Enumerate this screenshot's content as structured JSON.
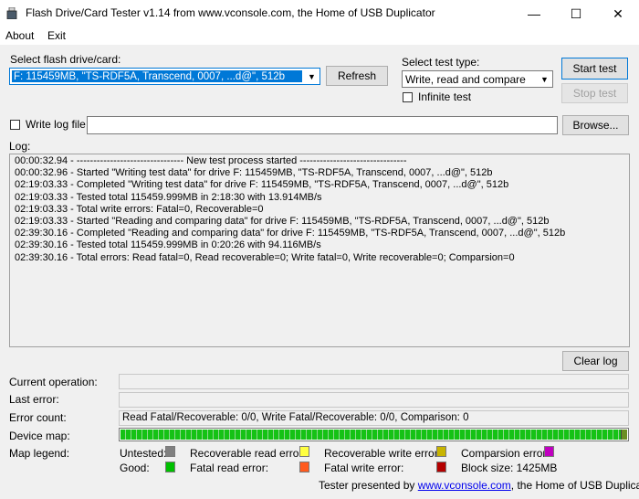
{
  "window": {
    "title": "Flash Drive/Card Tester v1.14 from www.vconsole.com, the Home of USB Duplicator",
    "minimize": "—",
    "maximize": "☐",
    "close": "✕"
  },
  "menu": {
    "about": "About",
    "exit": "Exit"
  },
  "drive": {
    "label": "Select flash drive/card:",
    "selected": "F: 115459MB, \"TS-RDF5A, Transcend, 0007, ...d@\", 512b",
    "refresh": "Refresh"
  },
  "test_type": {
    "label": "Select test type:",
    "selected": "Write, read and compare",
    "infinite_label": "Infinite test"
  },
  "buttons": {
    "start": "Start test",
    "stop": "Stop test",
    "browse": "Browse...",
    "clear_log": "Clear log"
  },
  "write_log": {
    "label": "Write log file",
    "value": ""
  },
  "log": {
    "label": "Log:",
    "lines": [
      "00:00:32.94 - -------------------------------- New test process started --------------------------------",
      "00:00:32.96 - Started \"Writing test data\" for drive F: 115459MB, \"TS-RDF5A, Transcend, 0007, ...d@\", 512b",
      "02:19:03.33 - Completed \"Writing test data\" for drive F: 115459MB, \"TS-RDF5A, Transcend, 0007, ...d@\", 512b",
      "02:19:03.33 - Tested total 115459.999MB in 2:18:30 with 13.914MB/s",
      "02:19:03.33 - Total write errors: Fatal=0, Recoverable=0",
      "02:19:03.33 - Started \"Reading and comparing data\" for drive F: 115459MB, \"TS-RDF5A, Transcend, 0007, ...d@\", 512b",
      "02:39:30.16 - Completed \"Reading and comparing data\" for drive F: 115459MB, \"TS-RDF5A, Transcend, 0007, ...d@\", 512b",
      "02:39:30.16 - Tested total 115459.999MB in 0:20:26 with 94.116MB/s",
      "02:39:30.16 - Total errors: Read fatal=0, Read recoverable=0; Write fatal=0, Write recoverable=0; Comparsion=0"
    ]
  },
  "status": {
    "current_operation_label": "Current operation:",
    "current_operation": "",
    "last_error_label": "Last error:",
    "last_error": "",
    "error_count_label": "Error count:",
    "error_count": "Read Fatal/Recoverable: 0/0, Write Fatal/Recoverable: 0/0, Comparison: 0",
    "device_map_label": "Device map:",
    "map_legend_label": "Map legend:"
  },
  "legend": {
    "untested": {
      "label": "Untested:",
      "color": "#808080"
    },
    "good": {
      "label": "Good:",
      "color": "#00c000"
    },
    "recoverable_read": {
      "label": "Recoverable read error:",
      "color": "#ffff40"
    },
    "fatal_read": {
      "label": "Fatal read error:",
      "color": "#ff5a1e"
    },
    "recoverable_write": {
      "label": "Recoverable write error:",
      "color": "#c8b400"
    },
    "fatal_write": {
      "label": "Fatal write error:",
      "color": "#b40000"
    },
    "comparison": {
      "label": "Comparsion error:",
      "color": "#c000c0"
    },
    "block_size": "Block size:  1425MB"
  },
  "footer": {
    "prefix": "Tester presented by",
    "link": "www.vconsole.com",
    "suffix": ", the Home of USB Duplicator."
  }
}
